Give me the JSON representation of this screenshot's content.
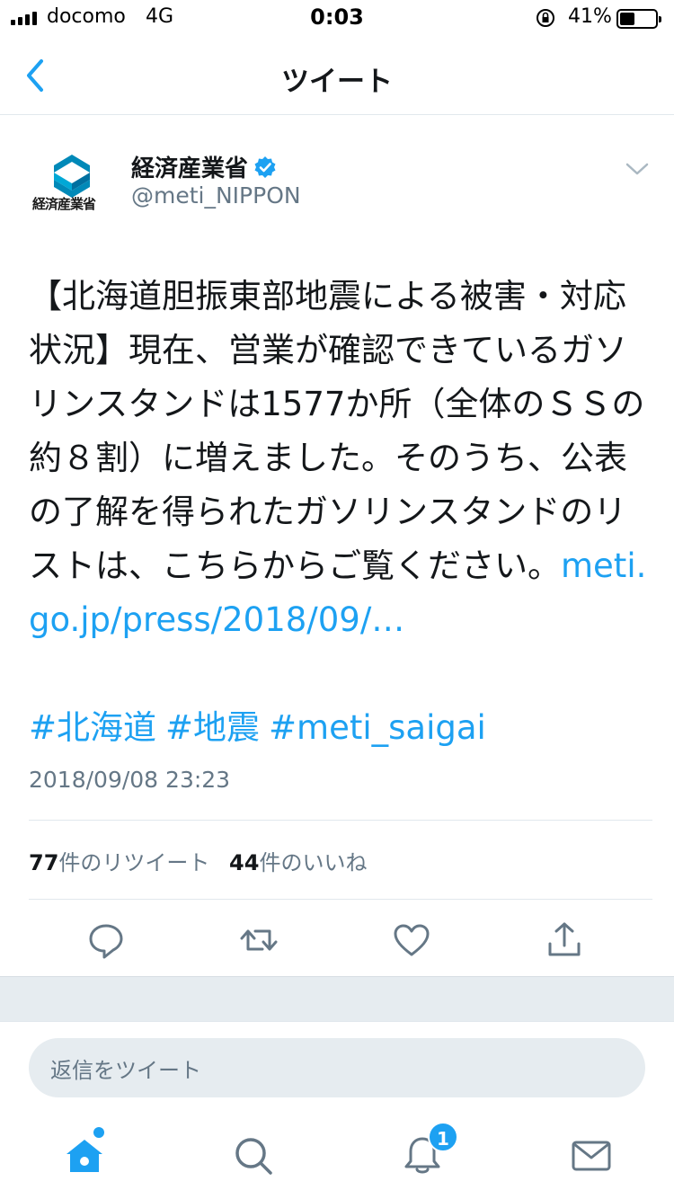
{
  "status_bar": {
    "carrier": "docomo",
    "network": "4G",
    "time": "0:03",
    "battery_percent": "41%",
    "battery_level": 0.41
  },
  "nav": {
    "title": "ツイート",
    "back_icon": "chevron-left-icon"
  },
  "tweet": {
    "avatar_caption": "経済産業省",
    "display_name": "経済産業省",
    "verified_icon": "verified-badge-icon",
    "handle": "@meti_NIPPON",
    "text": "【北海道胆振東部地震による被害・対応状況】現在、営業が確認できているガソリンスタンドは1577か所（全体のＳＳの約８割）に増えました。そのうち、公表の了解を得られたガソリンスタンドのリストは、こちらからご覧ください。",
    "link": "meti.go.jp/press/2018/09/…",
    "hashtags": [
      "#北海道",
      "#地震",
      "#meti_saigai"
    ],
    "timestamp": "2018/09/08 23:23",
    "retweet_count": "77",
    "retweet_label": "件のリツイート",
    "like_count": "44",
    "like_label": "件のいいね"
  },
  "actions": [
    "reply-icon",
    "retweet-icon",
    "heart-icon",
    "share-icon"
  ],
  "reply": {
    "placeholder": "返信をツイート"
  },
  "tab_bar": {
    "items": [
      "home-icon",
      "search-icon",
      "notifications-icon",
      "messages-icon"
    ],
    "notification_badge": "1"
  },
  "colors": {
    "accent": "#1da1f2",
    "secondary_text": "#657786",
    "divider": "#e1e8ed",
    "background_gray": "#e6ecf0"
  }
}
